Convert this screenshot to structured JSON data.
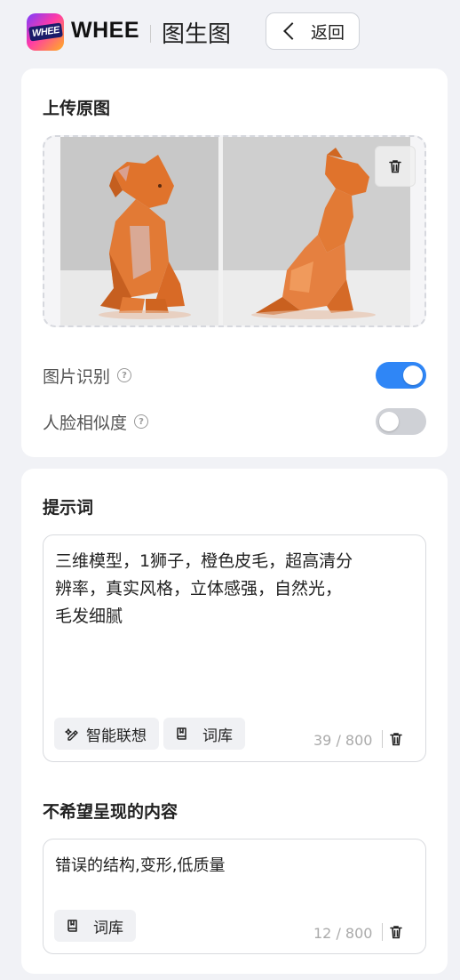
{
  "header": {
    "logo_badge": "WHEE",
    "logo_text": "WHEE",
    "title": "图生图",
    "back_label": "返回"
  },
  "upload": {
    "title": "上传原图",
    "image_alt": "lowpoly-orange-lion-cub-front-and-side-views"
  },
  "toggles": [
    {
      "label": "图片识别",
      "state": "on"
    },
    {
      "label": "人脸相似度",
      "state": "off"
    }
  ],
  "prompt": {
    "title": "提示词",
    "text": "三维模型，1狮子，橙色皮毛，超高清分\n辨率，真实风格，立体感强，自然光，\n毛发细腻",
    "smart_label": "智能联想",
    "library_label": "词库",
    "counter": "39 / 800"
  },
  "negative": {
    "title": "不希望呈现的内容",
    "text": "错误的结构,变形,低质量",
    "library_label": "词库",
    "counter": "12 / 800"
  },
  "colors": {
    "accent": "#2f86f6",
    "toggle_off": "#cfd1d6",
    "lion_orange": "#e0732c"
  },
  "icons": [
    "chevron-left-icon",
    "trash-icon",
    "help-icon",
    "sparkle-pen-icon",
    "book-icon"
  ]
}
